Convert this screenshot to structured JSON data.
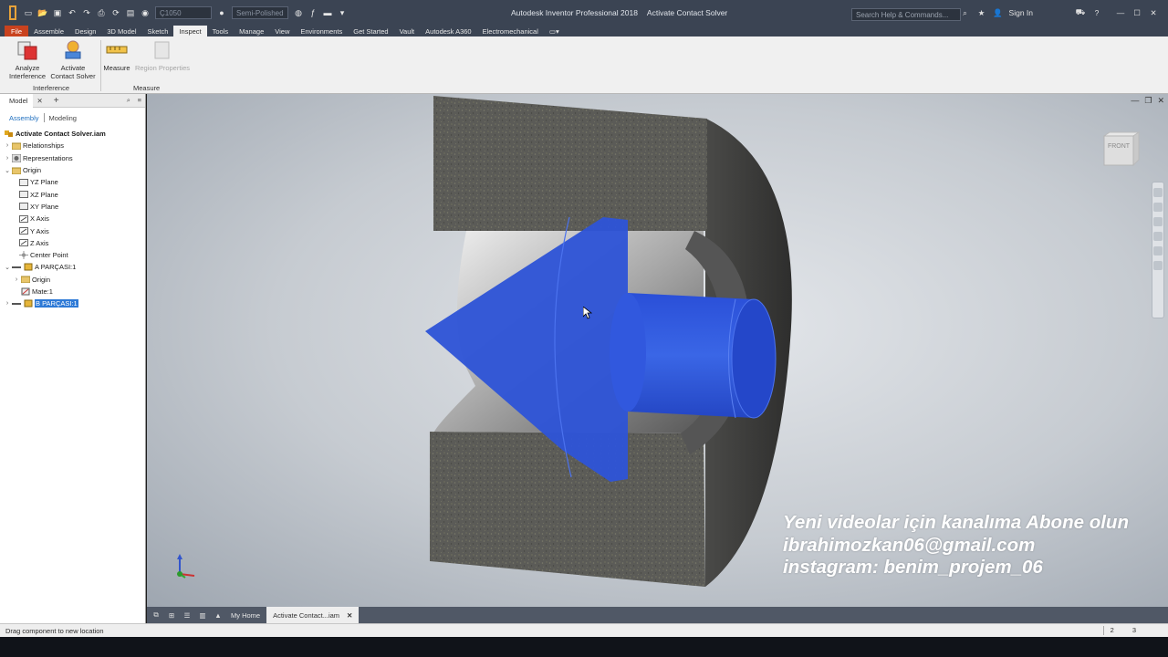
{
  "app": {
    "window_title": "Autodesk Inventor Professional 2018",
    "document_title": "Activate Contact Solver",
    "search_placeholder": "Search Help & Commands...",
    "sign_in": "Sign In",
    "material": "Ç1050",
    "appearance": "Semi-Polished"
  },
  "ribbon": {
    "tabs": [
      "File",
      "Assemble",
      "Design",
      "3D Model",
      "Sketch",
      "Inspect",
      "Tools",
      "Manage",
      "View",
      "Environments",
      "Get Started",
      "Vault",
      "Autodesk A360",
      "Electromechanical"
    ],
    "active_tab": "Inspect",
    "buttons": {
      "analyze_line1": "Analyze",
      "analyze_line2": "Interference",
      "contact_line1": "Activate",
      "contact_line2": "Contact Solver",
      "measure": "Measure",
      "region_properties": "Region Properties"
    },
    "groups": {
      "interference": "Interference",
      "measure": "Measure"
    }
  },
  "browser": {
    "tab": "Model",
    "subtabs": {
      "assembly": "Assembly",
      "modeling": "Modeling"
    },
    "root": "Activate Contact Solver.iam",
    "items": {
      "relationships": "Relationships",
      "representations": "Representations",
      "origin": "Origin",
      "yz_plane": "YZ Plane",
      "xz_plane": "XZ Plane",
      "xy_plane": "XY Plane",
      "x_axis": "X Axis",
      "y_axis": "Y Axis",
      "z_axis": "Z Axis",
      "center_point": "Center Point",
      "part_a": "A PARÇASI:1",
      "part_a_origin": "Origin",
      "mate": "Mate:1",
      "part_b": "B PARÇASI:1"
    }
  },
  "viewport": {
    "viewcube_face": "FRONT",
    "overlay_line1": "Yeni videolar için kanalıma Abone olun",
    "overlay_line2": "ibrahimozkan06@gmail.com",
    "overlay_line3": "instagram: benim_projem_06",
    "colors": {
      "cone_blue": "#2f56d8",
      "stone_gray": "#5a5a56"
    }
  },
  "doc_tabs": {
    "home": "My Home",
    "active": "Activate Contact...iam"
  },
  "status": {
    "message": "Drag component to new location",
    "count1": "2",
    "count2": "3"
  }
}
